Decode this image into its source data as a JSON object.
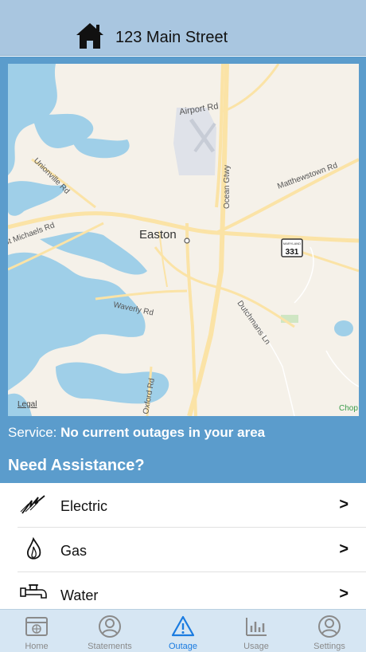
{
  "header": {
    "address": "123 Main Street",
    "icon": "home-icon"
  },
  "map": {
    "labels": {
      "town": "Easton",
      "airport_rd": "Airport Rd",
      "matthewstown_rd": "Matthewstown Rd",
      "unionville_rd": "Unionville Rd",
      "ocean_gtwy": "Ocean Gtwy",
      "st_michaels_rd": "St Michaels Rd",
      "route_shield": "331",
      "route_state": "MARYLAND",
      "waverly_rd": "Waverly Rd",
      "dutchmans_ln": "Dutchmans Ln",
      "oxford_rd": "Oxford Rd",
      "legal": "Legal",
      "chop": "Chop"
    }
  },
  "service": {
    "label": "Service:",
    "value": "No current outages in your area"
  },
  "assistance": {
    "heading": "Need Assistance?",
    "items": [
      {
        "label": "Electric",
        "icon": "lightning-icon",
        "chevron": ">"
      },
      {
        "label": "Gas",
        "icon": "flame-icon",
        "chevron": ">"
      },
      {
        "label": "Water",
        "icon": "faucet-icon",
        "chevron": ">"
      }
    ]
  },
  "tabbar": {
    "active": "Outage",
    "tabs": [
      {
        "label": "Home",
        "icon": "browser-window-icon"
      },
      {
        "label": "Statements",
        "icon": "person-circle-icon"
      },
      {
        "label": "Outage",
        "icon": "warning-triangle-icon"
      },
      {
        "label": "Usage",
        "icon": "bar-chart-icon"
      },
      {
        "label": "Settings",
        "icon": "person-circle-icon"
      }
    ]
  },
  "colors": {
    "header": "#a9c6e0",
    "panel": "#5b9ccc",
    "active_tab": "#1a7be0",
    "tabbar": "#d6e6f3",
    "water": "#9fcfe8",
    "road": "#fbe3a6"
  }
}
